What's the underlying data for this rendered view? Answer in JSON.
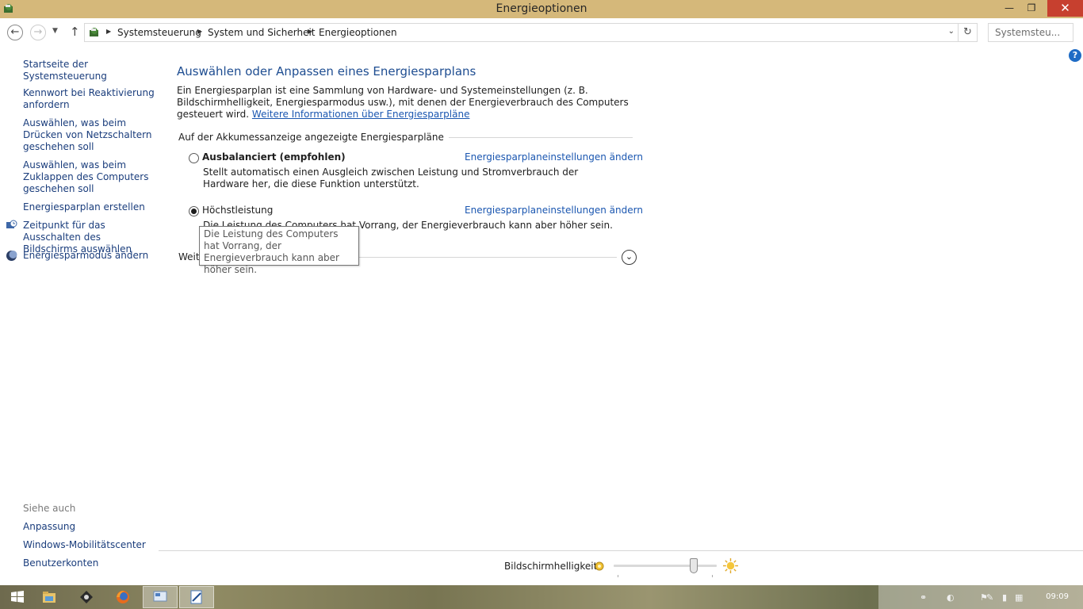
{
  "window": {
    "title": "Energieoptionen",
    "controls": {
      "minimize": "—",
      "maximize": "❐",
      "close": "✕"
    }
  },
  "address": {
    "crumbs": [
      "Systemsteuerung",
      "System und Sicherheit",
      "Energieoptionen"
    ],
    "search_placeholder": "Systemsteu..."
  },
  "sidebar": {
    "links": [
      "Startseite der Systemsteuerung",
      "Kennwort bei Reaktivierung anfordern",
      "Auswählen, was beim Drücken von Netzschaltern geschehen soll",
      "Auswählen, was beim Zuklappen des Computers geschehen soll",
      "Energiesparplan erstellen",
      "Zeitpunkt für das Ausschalten des Bildschirms auswählen",
      "Energiesparmodus ändern"
    ],
    "see_also_label": "Siehe auch",
    "see_also": [
      "Anpassung",
      "Windows-Mobilitätscenter",
      "Benutzerkonten"
    ]
  },
  "main": {
    "title": "Auswählen oder Anpassen eines Energiesparplans",
    "intro": "Ein Energiesparplan ist eine Sammlung von Hardware- und Systemeinstellungen (z. B. Bildschirmhelligkeit, Energiesparmodus usw.), mit denen der Energieverbrauch des Computers gesteuert wird.",
    "intro_link": "Weitere Informationen über Energiesparpläne",
    "group_title": "Auf der Akkumessanzeige angezeigte Energiesparpläne",
    "plans": [
      {
        "name": "Ausbalanciert (empfohlen)",
        "description": "Stellt automatisch einen Ausgleich zwischen Leistung und Stromverbrauch der Hardware her, die diese Funktion unterstützt.",
        "link": "Energiesparplaneinstellungen ändern",
        "selected": false
      },
      {
        "name": "Höchstleistung",
        "description": "Die Leistung des Computers hat Vorrang, der Energieverbrauch kann aber höher sein.",
        "link": "Energiesparplaneinstellungen ändern",
        "selected": true
      }
    ],
    "more_plans_label": "Weitere Energiesparpläne einblenden",
    "more_plans_visible": "Weite",
    "tooltip": "Die Leistung des Computers hat Vorrang, der Energieverbrauch kann aber höher sein."
  },
  "brightness": {
    "label": "Bildschirmhelligkeit:",
    "level": 0.8
  },
  "taskbar": {
    "clock": "09:09"
  },
  "colors": {
    "titlebar": "#d5b87a",
    "close": "#c7402f",
    "link": "#1a56b0",
    "heading": "#1e4d91"
  }
}
